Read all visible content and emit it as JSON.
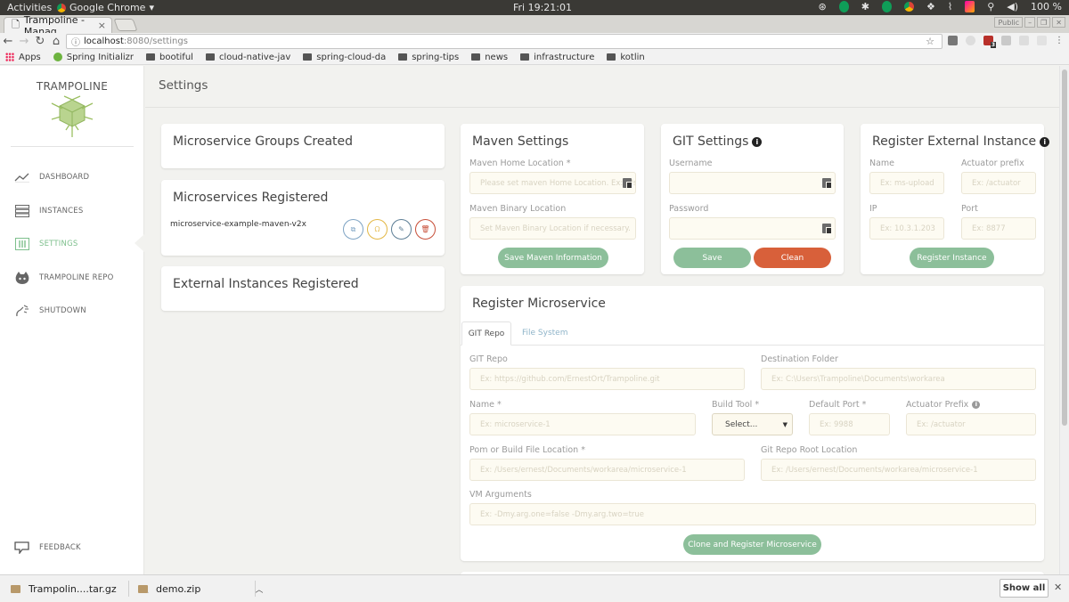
{
  "os_bar": {
    "activities": "Activities",
    "app_name": "Google Chrome",
    "clock": "Fri 19:21:01",
    "battery": "100 %"
  },
  "browser": {
    "tab_title": "Trampoline - Manag",
    "url_host": "localhost",
    "url_path": ":8080/settings",
    "profile": "Public",
    "extension_badge": "3",
    "bookmarks": [
      {
        "label": "Apps",
        "icon": "apps-grid-icon"
      },
      {
        "label": "Spring Initializr",
        "icon": "spring-icon"
      },
      {
        "label": "bootiful",
        "icon": "folder-icon"
      },
      {
        "label": "cloud-native-jav",
        "icon": "folder-icon"
      },
      {
        "label": "spring-cloud-da",
        "icon": "folder-icon"
      },
      {
        "label": "spring-tips",
        "icon": "folder-icon"
      },
      {
        "label": "news",
        "icon": "folder-icon"
      },
      {
        "label": "infrastructure",
        "icon": "folder-icon"
      },
      {
        "label": "kotlin",
        "icon": "folder-icon"
      }
    ]
  },
  "sidebar": {
    "brand": "TRAMPOLINE",
    "items": [
      {
        "label": "DASHBOARD",
        "icon": "trend-line-icon",
        "active": false
      },
      {
        "label": "INSTANCES",
        "icon": "server-list-icon",
        "active": false
      },
      {
        "label": "SETTINGS",
        "icon": "sliders-icon",
        "active": true
      },
      {
        "label": "TRAMPOLINE REPO",
        "icon": "github-icon",
        "active": false
      },
      {
        "label": "SHUTDOWN",
        "icon": "unplug-icon",
        "active": false
      }
    ],
    "feedback": {
      "label": "FEEDBACK",
      "icon": "chat-bubble-icon"
    }
  },
  "page": {
    "title": "Settings"
  },
  "groups_card": {
    "title": "Microservice Groups Created"
  },
  "microservices_card": {
    "title": "Microservices Registered",
    "items": [
      {
        "name": "microservice-example-maven-v2x",
        "actions": [
          "copy",
          "github",
          "edit",
          "delete"
        ]
      }
    ]
  },
  "external_card": {
    "title": "External Instances Registered"
  },
  "maven": {
    "title": "Maven Settings",
    "home_label": "Maven Home Location *",
    "home_placeholder": "Please set maven Home Location. Ex: /Users/...",
    "binary_label": "Maven Binary Location",
    "binary_placeholder": "Set Maven Binary Location if necessary.",
    "save": "Save Maven Information"
  },
  "git": {
    "title": "GIT Settings",
    "username_label": "Username",
    "username_value": "",
    "password_label": "Password",
    "password_value": "",
    "save": "Save",
    "clean": "Clean"
  },
  "external": {
    "title": "Register External Instance",
    "name_label": "Name",
    "name_placeholder": "Ex: ms-upload",
    "actuator_label": "Actuator prefix",
    "actuator_placeholder": "Ex: /actuator",
    "ip_label": "IP",
    "ip_placeholder": "Ex: 10.3.1.203",
    "port_label": "Port",
    "port_placeholder": "Ex: 8877",
    "submit": "Register Instance"
  },
  "register": {
    "title": "Register Microservice",
    "tabs": [
      {
        "label": "GIT Repo",
        "active": true
      },
      {
        "label": "File System",
        "active": false
      }
    ],
    "git_repo_label": "GIT Repo",
    "git_repo_placeholder": "Ex: https://github.com/ErnestOrt/Trampoline.git",
    "dest_label": "Destination Folder",
    "dest_placeholder": "Ex: C:\\Users\\Trampoline\\Documents\\workarea",
    "name_label": "Name *",
    "name_placeholder": "Ex: microservice-1",
    "build_label": "Build Tool *",
    "build_value": "Select...",
    "port_label": "Default Port *",
    "port_placeholder": "Ex: 9988",
    "actuator_label": "Actuator Prefix",
    "actuator_placeholder": "Ex: /actuator",
    "pom_label": "Pom or Build File Location *",
    "pom_placeholder": "Ex: /Users/ernest/Documents/workarea/microservice-1",
    "root_label": "Git Repo Root Location",
    "root_placeholder": "Ex: /Users/ernest/Documents/workarea/microservice-1",
    "vm_label": "VM Arguments",
    "vm_placeholder": "Ex: -Dmy.arg.one=false -Dmy.arg.two=true",
    "submit": "Clone and Register Microservice"
  },
  "downloads": {
    "items": [
      {
        "name": "Trampolin....tar.gz"
      },
      {
        "name": "demo.zip"
      }
    ],
    "show_all": "Show all"
  },
  "colors": {
    "accent_green": "#8cbf9a",
    "danger_orange": "#d8603a",
    "input_bg": "#fdfbf2"
  }
}
